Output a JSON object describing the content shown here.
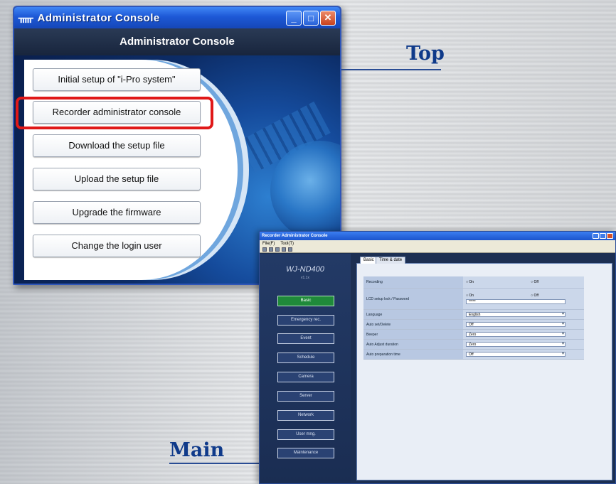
{
  "top_window": {
    "titlebar": "Administrator Console",
    "header": "Administrator Console",
    "buttons": [
      "Initial setup of \"i-Pro system\"",
      "Recorder administrator console",
      "Download the setup file",
      "Upload the setup file",
      "Upgrade the firmware",
      "Change the login user"
    ],
    "highlighted_button_index": 1,
    "colors": {
      "highlight": "#e01818",
      "title_bar": "#1d58d6"
    }
  },
  "labels": {
    "top": "Top",
    "main": "Main"
  },
  "main_window": {
    "title": "Recorder Administrator Console",
    "menu": [
      "File(F)",
      "Tool(T)"
    ],
    "model": "WJ-ND400",
    "version": "v1.1x",
    "side_buttons": [
      "Basic",
      "Emergency rec.",
      "Event",
      "Schedule",
      "Camera",
      "Server",
      "Network",
      "User mng.",
      "Maintenance"
    ],
    "active_side": "Basic",
    "tabs": [
      "Basic",
      "Time & date"
    ],
    "settings": {
      "recording": {
        "label": "Recording",
        "on": "On",
        "off": "Off"
      },
      "lcd": {
        "label": "LCD setup lock / Password",
        "on": "On",
        "off": "Off",
        "value": "*****"
      },
      "language": {
        "label": "Language",
        "value": "English"
      },
      "auto_set": {
        "label": "Auto set/Delete",
        "value": "Off"
      },
      "beeper": {
        "label": "Beeper",
        "value": "Zero"
      },
      "auto_set_duration": {
        "label": "Auto Adjust duration",
        "value": "Zero"
      },
      "auto_preparation": {
        "label": "Auto preparation time",
        "value": "Off"
      }
    }
  }
}
